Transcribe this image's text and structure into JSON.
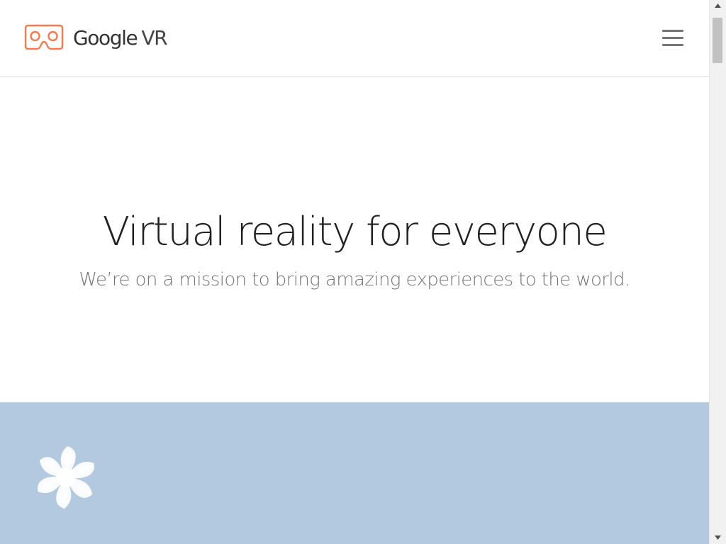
{
  "header": {
    "logo_brand": "Google",
    "logo_product": "VR",
    "logo_icon": "cardboard-viewer-icon",
    "menu_icon": "hamburger-menu-icon"
  },
  "hero": {
    "title": "Virtual reality for everyone",
    "subtitle": "We’re on a mission to bring amazing experiences to the world."
  },
  "band": {
    "icon": "daydream-pinwheel-icon"
  },
  "colors": {
    "accent": "#f47b4f",
    "band_background": "#b3c9df",
    "title_text": "#212121",
    "subtitle_text": "#757575"
  }
}
